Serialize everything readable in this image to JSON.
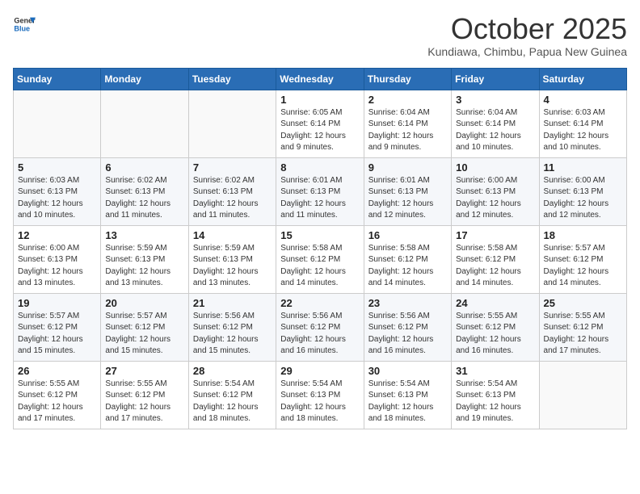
{
  "header": {
    "logo_line1": "General",
    "logo_line2": "Blue",
    "month": "October 2025",
    "location": "Kundiawa, Chimbu, Papua New Guinea"
  },
  "weekdays": [
    "Sunday",
    "Monday",
    "Tuesday",
    "Wednesday",
    "Thursday",
    "Friday",
    "Saturday"
  ],
  "weeks": [
    [
      {
        "day": "",
        "info": ""
      },
      {
        "day": "",
        "info": ""
      },
      {
        "day": "",
        "info": ""
      },
      {
        "day": "1",
        "info": "Sunrise: 6:05 AM\nSunset: 6:14 PM\nDaylight: 12 hours\nand 9 minutes."
      },
      {
        "day": "2",
        "info": "Sunrise: 6:04 AM\nSunset: 6:14 PM\nDaylight: 12 hours\nand 9 minutes."
      },
      {
        "day": "3",
        "info": "Sunrise: 6:04 AM\nSunset: 6:14 PM\nDaylight: 12 hours\nand 10 minutes."
      },
      {
        "day": "4",
        "info": "Sunrise: 6:03 AM\nSunset: 6:14 PM\nDaylight: 12 hours\nand 10 minutes."
      }
    ],
    [
      {
        "day": "5",
        "info": "Sunrise: 6:03 AM\nSunset: 6:13 PM\nDaylight: 12 hours\nand 10 minutes."
      },
      {
        "day": "6",
        "info": "Sunrise: 6:02 AM\nSunset: 6:13 PM\nDaylight: 12 hours\nand 11 minutes."
      },
      {
        "day": "7",
        "info": "Sunrise: 6:02 AM\nSunset: 6:13 PM\nDaylight: 12 hours\nand 11 minutes."
      },
      {
        "day": "8",
        "info": "Sunrise: 6:01 AM\nSunset: 6:13 PM\nDaylight: 12 hours\nand 11 minutes."
      },
      {
        "day": "9",
        "info": "Sunrise: 6:01 AM\nSunset: 6:13 PM\nDaylight: 12 hours\nand 12 minutes."
      },
      {
        "day": "10",
        "info": "Sunrise: 6:00 AM\nSunset: 6:13 PM\nDaylight: 12 hours\nand 12 minutes."
      },
      {
        "day": "11",
        "info": "Sunrise: 6:00 AM\nSunset: 6:13 PM\nDaylight: 12 hours\nand 12 minutes."
      }
    ],
    [
      {
        "day": "12",
        "info": "Sunrise: 6:00 AM\nSunset: 6:13 PM\nDaylight: 12 hours\nand 13 minutes."
      },
      {
        "day": "13",
        "info": "Sunrise: 5:59 AM\nSunset: 6:13 PM\nDaylight: 12 hours\nand 13 minutes."
      },
      {
        "day": "14",
        "info": "Sunrise: 5:59 AM\nSunset: 6:13 PM\nDaylight: 12 hours\nand 13 minutes."
      },
      {
        "day": "15",
        "info": "Sunrise: 5:58 AM\nSunset: 6:12 PM\nDaylight: 12 hours\nand 14 minutes."
      },
      {
        "day": "16",
        "info": "Sunrise: 5:58 AM\nSunset: 6:12 PM\nDaylight: 12 hours\nand 14 minutes."
      },
      {
        "day": "17",
        "info": "Sunrise: 5:58 AM\nSunset: 6:12 PM\nDaylight: 12 hours\nand 14 minutes."
      },
      {
        "day": "18",
        "info": "Sunrise: 5:57 AM\nSunset: 6:12 PM\nDaylight: 12 hours\nand 14 minutes."
      }
    ],
    [
      {
        "day": "19",
        "info": "Sunrise: 5:57 AM\nSunset: 6:12 PM\nDaylight: 12 hours\nand 15 minutes."
      },
      {
        "day": "20",
        "info": "Sunrise: 5:57 AM\nSunset: 6:12 PM\nDaylight: 12 hours\nand 15 minutes."
      },
      {
        "day": "21",
        "info": "Sunrise: 5:56 AM\nSunset: 6:12 PM\nDaylight: 12 hours\nand 15 minutes."
      },
      {
        "day": "22",
        "info": "Sunrise: 5:56 AM\nSunset: 6:12 PM\nDaylight: 12 hours\nand 16 minutes."
      },
      {
        "day": "23",
        "info": "Sunrise: 5:56 AM\nSunset: 6:12 PM\nDaylight: 12 hours\nand 16 minutes."
      },
      {
        "day": "24",
        "info": "Sunrise: 5:55 AM\nSunset: 6:12 PM\nDaylight: 12 hours\nand 16 minutes."
      },
      {
        "day": "25",
        "info": "Sunrise: 5:55 AM\nSunset: 6:12 PM\nDaylight: 12 hours\nand 17 minutes."
      }
    ],
    [
      {
        "day": "26",
        "info": "Sunrise: 5:55 AM\nSunset: 6:12 PM\nDaylight: 12 hours\nand 17 minutes."
      },
      {
        "day": "27",
        "info": "Sunrise: 5:55 AM\nSunset: 6:12 PM\nDaylight: 12 hours\nand 17 minutes."
      },
      {
        "day": "28",
        "info": "Sunrise: 5:54 AM\nSunset: 6:12 PM\nDaylight: 12 hours\nand 18 minutes."
      },
      {
        "day": "29",
        "info": "Sunrise: 5:54 AM\nSunset: 6:13 PM\nDaylight: 12 hours\nand 18 minutes."
      },
      {
        "day": "30",
        "info": "Sunrise: 5:54 AM\nSunset: 6:13 PM\nDaylight: 12 hours\nand 18 minutes."
      },
      {
        "day": "31",
        "info": "Sunrise: 5:54 AM\nSunset: 6:13 PM\nDaylight: 12 hours\nand 19 minutes."
      },
      {
        "day": "",
        "info": ""
      }
    ]
  ]
}
